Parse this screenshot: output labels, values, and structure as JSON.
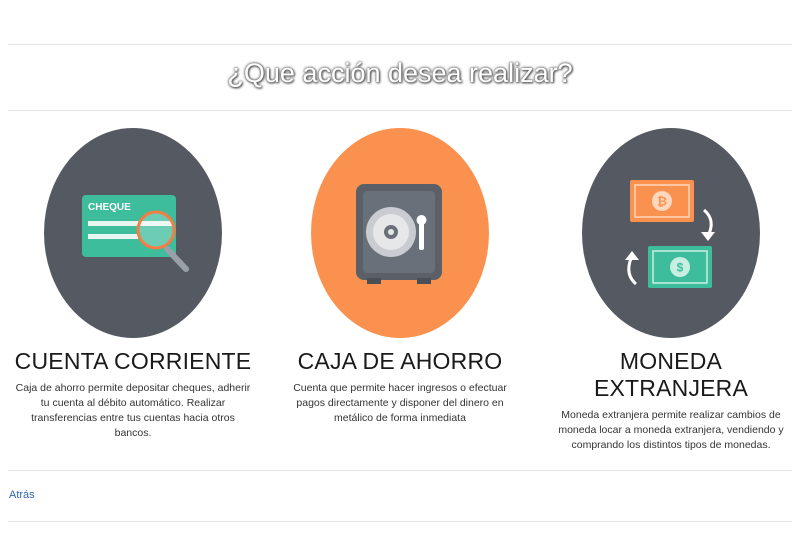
{
  "header": {
    "title": "¿Que acción desea realizar?"
  },
  "options": [
    {
      "title": "CUENTA CORRIENTE",
      "description": "Caja de ahorro permite depositar cheques, adherir tu cuenta al débito automático. Realizar transferencias entre tus cuentas hacia otros bancos.",
      "circle_color": "#555a62",
      "icon": "cheque-icon",
      "icon_text": "CHEQUE"
    },
    {
      "title": "CAJA DE AHORRO",
      "description": "Cuenta que permite hacer ingresos o efectuar pagos directamente y disponer del dinero en metálico de forma inmediata",
      "circle_color": "#fa914f",
      "icon": "safe-icon"
    },
    {
      "title": "MONEDA EXTRANJERA",
      "description": "Moneda extranjera permite realizar cambios de moneda locar a moneda extranjera, vendiendo y comprando los distintos tipos de monedas.",
      "circle_color": "#555a62",
      "icon": "currency-exchange-icon"
    }
  ],
  "footer": {
    "back_label": "Atrás"
  }
}
